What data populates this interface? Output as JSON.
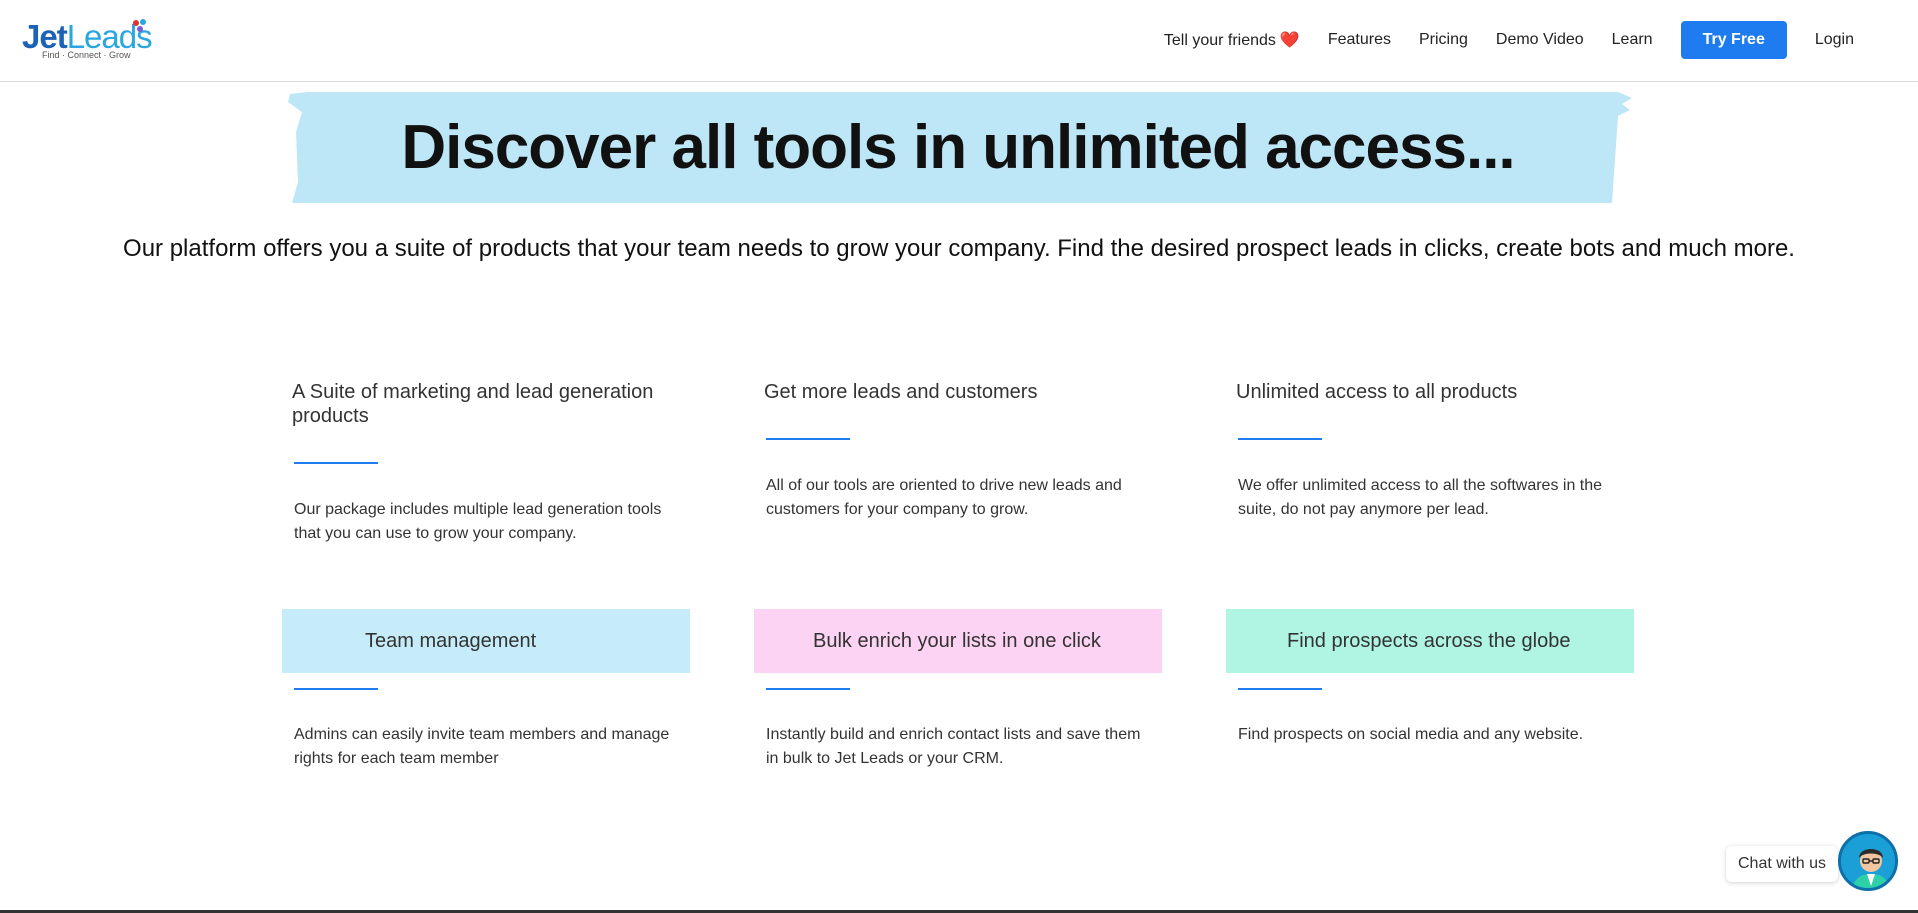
{
  "logo": {
    "part1": "Jet",
    "part2": "Leads",
    "tagline": "Find · Connect · Grow"
  },
  "nav": {
    "items": [
      "Tell your friends",
      "Features",
      "Pricing",
      "Demo Video",
      "Learn"
    ],
    "heart_icon": "heart-icon",
    "try_label": "Try Free",
    "login_label": "Login"
  },
  "hero": {
    "title": "Discover all tools in unlimited access...",
    "subtitle": "Our platform offers you a suite of products that your team needs to grow your company. Find the desired prospect leads in clicks, create bots and much more."
  },
  "features": [
    {
      "title": "A Suite of marketing and lead generation products",
      "desc": "Our package includes multiple lead generation tools that you can use to grow your company."
    },
    {
      "title": "Get more leads and customers",
      "desc": "All of our tools are oriented to drive new leads and customers for your company to grow."
    },
    {
      "title": "Unlimited access to all products",
      "desc": "We offer unlimited access to all the softwares in the suite, do not pay anymore per lead."
    },
    {
      "title": "Team management",
      "desc": "Admins can easily invite team members and manage rights for each team member"
    },
    {
      "title": "Bulk enrich your lists in one click",
      "desc": "Instantly build and enrich contact lists and save them in bulk to Jet Leads or your CRM."
    },
    {
      "title": "Find prospects across the globe",
      "desc": "Find prospects on social media and any website."
    }
  ],
  "chat": {
    "label": "Chat with us",
    "avatar_icon": "support-agent-avatar"
  },
  "colors": {
    "accent": "#1f7cf0",
    "hero_band": "#bde6f7",
    "box_blue": "#c6ecfa",
    "box_pink": "#fdd3f3",
    "box_green": "#b0f5e4"
  }
}
